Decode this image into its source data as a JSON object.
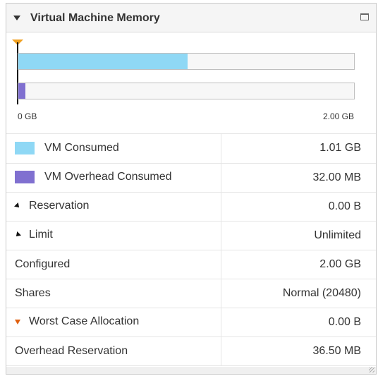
{
  "panel": {
    "title": "Virtual Machine Memory",
    "icons": {
      "collapse": "collapse-triangle-icon",
      "maximize": "maximize-icon",
      "grip": "resize-grip-icon"
    }
  },
  "bar_chart": {
    "axis_min_label": "0 GB",
    "axis_max_label": "2.00 GB",
    "bars": [
      {
        "name": "VM Consumed",
        "fraction": 0.505,
        "color": "#8fd8f5"
      },
      {
        "name": "VM Overhead Consumed",
        "fraction": 0.02,
        "color": "#8070d0"
      }
    ],
    "reservation_marker_color": "#f0a020"
  },
  "rows": [
    {
      "label": "VM Consumed",
      "value": "1.01 GB",
      "swatch": "#8fd8f5"
    },
    {
      "label": "VM Overhead Consumed",
      "value": "32.00 MB",
      "swatch": "#8070d0"
    },
    {
      "label": "Reservation",
      "value": "0.00 B",
      "icon": "reservation-marker-icon"
    },
    {
      "label": "Limit",
      "value": "Unlimited",
      "icon": "limit-marker-icon"
    },
    {
      "label": "Configured",
      "value": "2.00 GB"
    },
    {
      "label": "Shares",
      "value": "Normal (20480)"
    },
    {
      "label": "Worst Case Allocation",
      "value": "0.00 B",
      "icon": "worst-case-marker-icon",
      "icon_color": "#e06010"
    },
    {
      "label": "Overhead Reservation",
      "value": "36.50 MB"
    }
  ]
}
